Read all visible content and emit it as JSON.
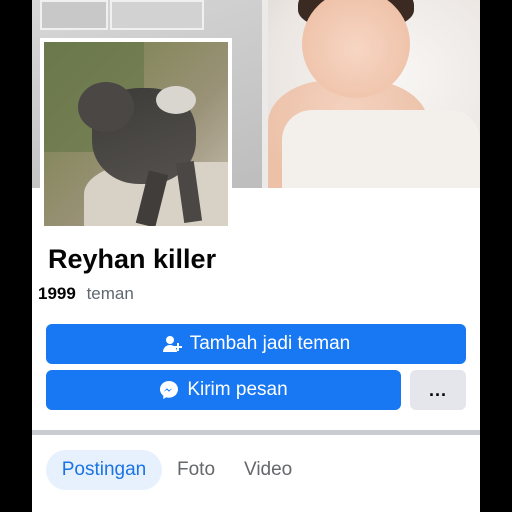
{
  "profile": {
    "name": "Reyhan killer",
    "friends_count": "1999",
    "friends_label": "teman"
  },
  "actions": {
    "add_friend_label": "Tambah jadi teman",
    "message_label": "Kirim pesan",
    "more_label": "..."
  },
  "tabs": [
    {
      "label": "Postingan",
      "active": true
    },
    {
      "label": "Foto",
      "active": false
    },
    {
      "label": "Video",
      "active": false
    }
  ],
  "icons": {
    "add_friend": "add-friend-icon",
    "messenger": "messenger-icon",
    "more": "more-icon"
  },
  "colors": {
    "accent": "#1877f2",
    "tab_active_bg": "#e7f0fd",
    "tab_active_text": "#1b74e4",
    "secondary_button": "#e4e6eb"
  }
}
